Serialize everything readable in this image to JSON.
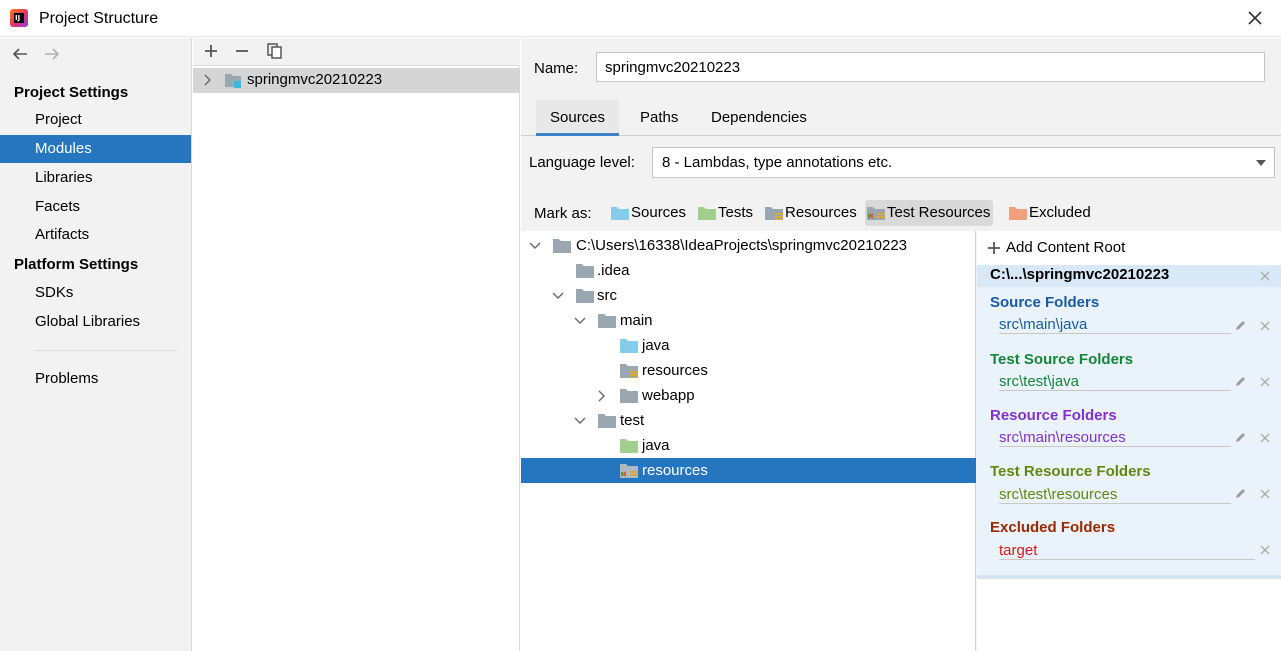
{
  "window": {
    "title": "Project Structure"
  },
  "nav": {
    "sections": [
      {
        "title": "Project Settings",
        "items": [
          "Project",
          "Modules",
          "Libraries",
          "Facets",
          "Artifacts"
        ]
      },
      {
        "title": "Platform Settings",
        "items": [
          "SDKs",
          "Global Libraries"
        ]
      }
    ],
    "selected": "Modules",
    "problems": "Problems"
  },
  "modules": {
    "items": [
      "springmvc20210223"
    ]
  },
  "detail": {
    "name_label": "Name:",
    "name_value": "springmvc20210223",
    "tabs": [
      "Sources",
      "Paths",
      "Dependencies"
    ],
    "active_tab": "Sources",
    "language_label": "Language level:",
    "language_value": "8 - Lambdas, type annotations etc.",
    "mark_as_label": "Mark as:",
    "mark_as": [
      "Sources",
      "Tests",
      "Resources",
      "Test Resources",
      "Excluded"
    ],
    "mark_as_active": "Test Resources"
  },
  "tree": {
    "root": "C:\\Users\\16338\\IdeaProjects\\springmvc20210223",
    "nodes": [
      ".idea",
      "src",
      "main",
      "java",
      "resources",
      "webapp",
      "test",
      "java",
      "resources"
    ],
    "selected_index": 8
  },
  "content_root": {
    "add_label": "Add Content Root",
    "root_path": "C:\\...\\springmvc20210223",
    "source_folders_title": "Source Folders",
    "source_folders": [
      "src\\main\\java"
    ],
    "test_source_folders_title": "Test Source Folders",
    "test_source_folders": [
      "src\\test\\java"
    ],
    "resource_folders_title": "Resource Folders",
    "resource_folders": [
      "src\\main\\resources"
    ],
    "test_resource_folders_title": "Test Resource Folders",
    "test_resource_folders": [
      "src\\test\\resources"
    ],
    "excluded_folders_title": "Excluded Folders",
    "excluded_folders": [
      "target"
    ]
  },
  "colors": {
    "selection": "#2675bf",
    "sources": "#1a5aa0",
    "tests": "#16843b",
    "resources": "#8132cd",
    "test_resources": "#63860f",
    "excluded": "#9a2800",
    "excluded_entry": "#d8181b"
  },
  "icons": [
    "app-logo-icon",
    "close-icon",
    "back-arrow-icon",
    "forward-arrow-icon",
    "add-icon",
    "remove-icon",
    "copy-icon",
    "module-folder-icon",
    "folder-icon",
    "source-folder-icon",
    "test-folder-icon",
    "resources-folder-icon",
    "test-resources-folder-icon",
    "excluded-folder-icon",
    "chevron-right-icon",
    "chevron-down-icon",
    "edit-pencil-icon",
    "delete-x-icon"
  ]
}
